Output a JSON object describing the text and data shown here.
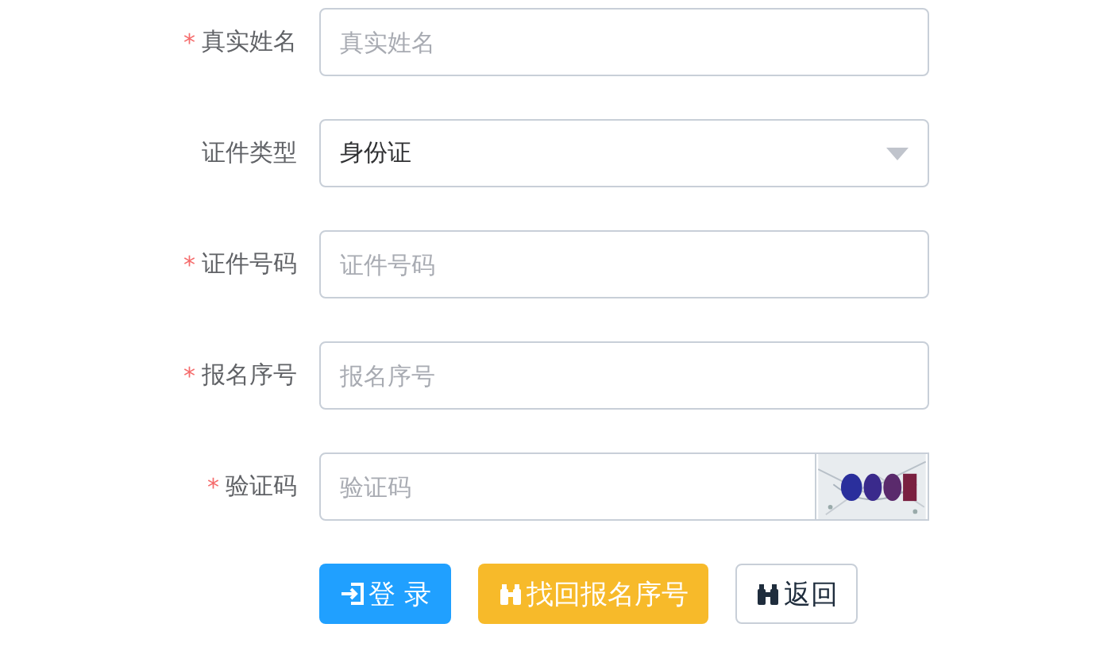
{
  "fields": [
    {
      "kind": "input",
      "required_mark": "*",
      "label": "真实姓名",
      "placeholder": "真实姓名"
    },
    {
      "kind": "select",
      "label": "证件类型",
      "value": "身份证"
    },
    {
      "kind": "input",
      "required_mark": "*",
      "label": "证件号码",
      "placeholder": "证件号码"
    },
    {
      "kind": "input",
      "required_mark": "*",
      "label": "报名序号",
      "placeholder": "报名序号"
    },
    {
      "kind": "captcha",
      "required_mark": "*",
      "label": "验证码",
      "placeholder": "验证码"
    }
  ],
  "buttons": [
    {
      "kind": "primary",
      "label": "登 录"
    },
    {
      "kind": "warning",
      "label": "找回报名序号"
    },
    {
      "kind": "default",
      "label": "返回"
    }
  ]
}
